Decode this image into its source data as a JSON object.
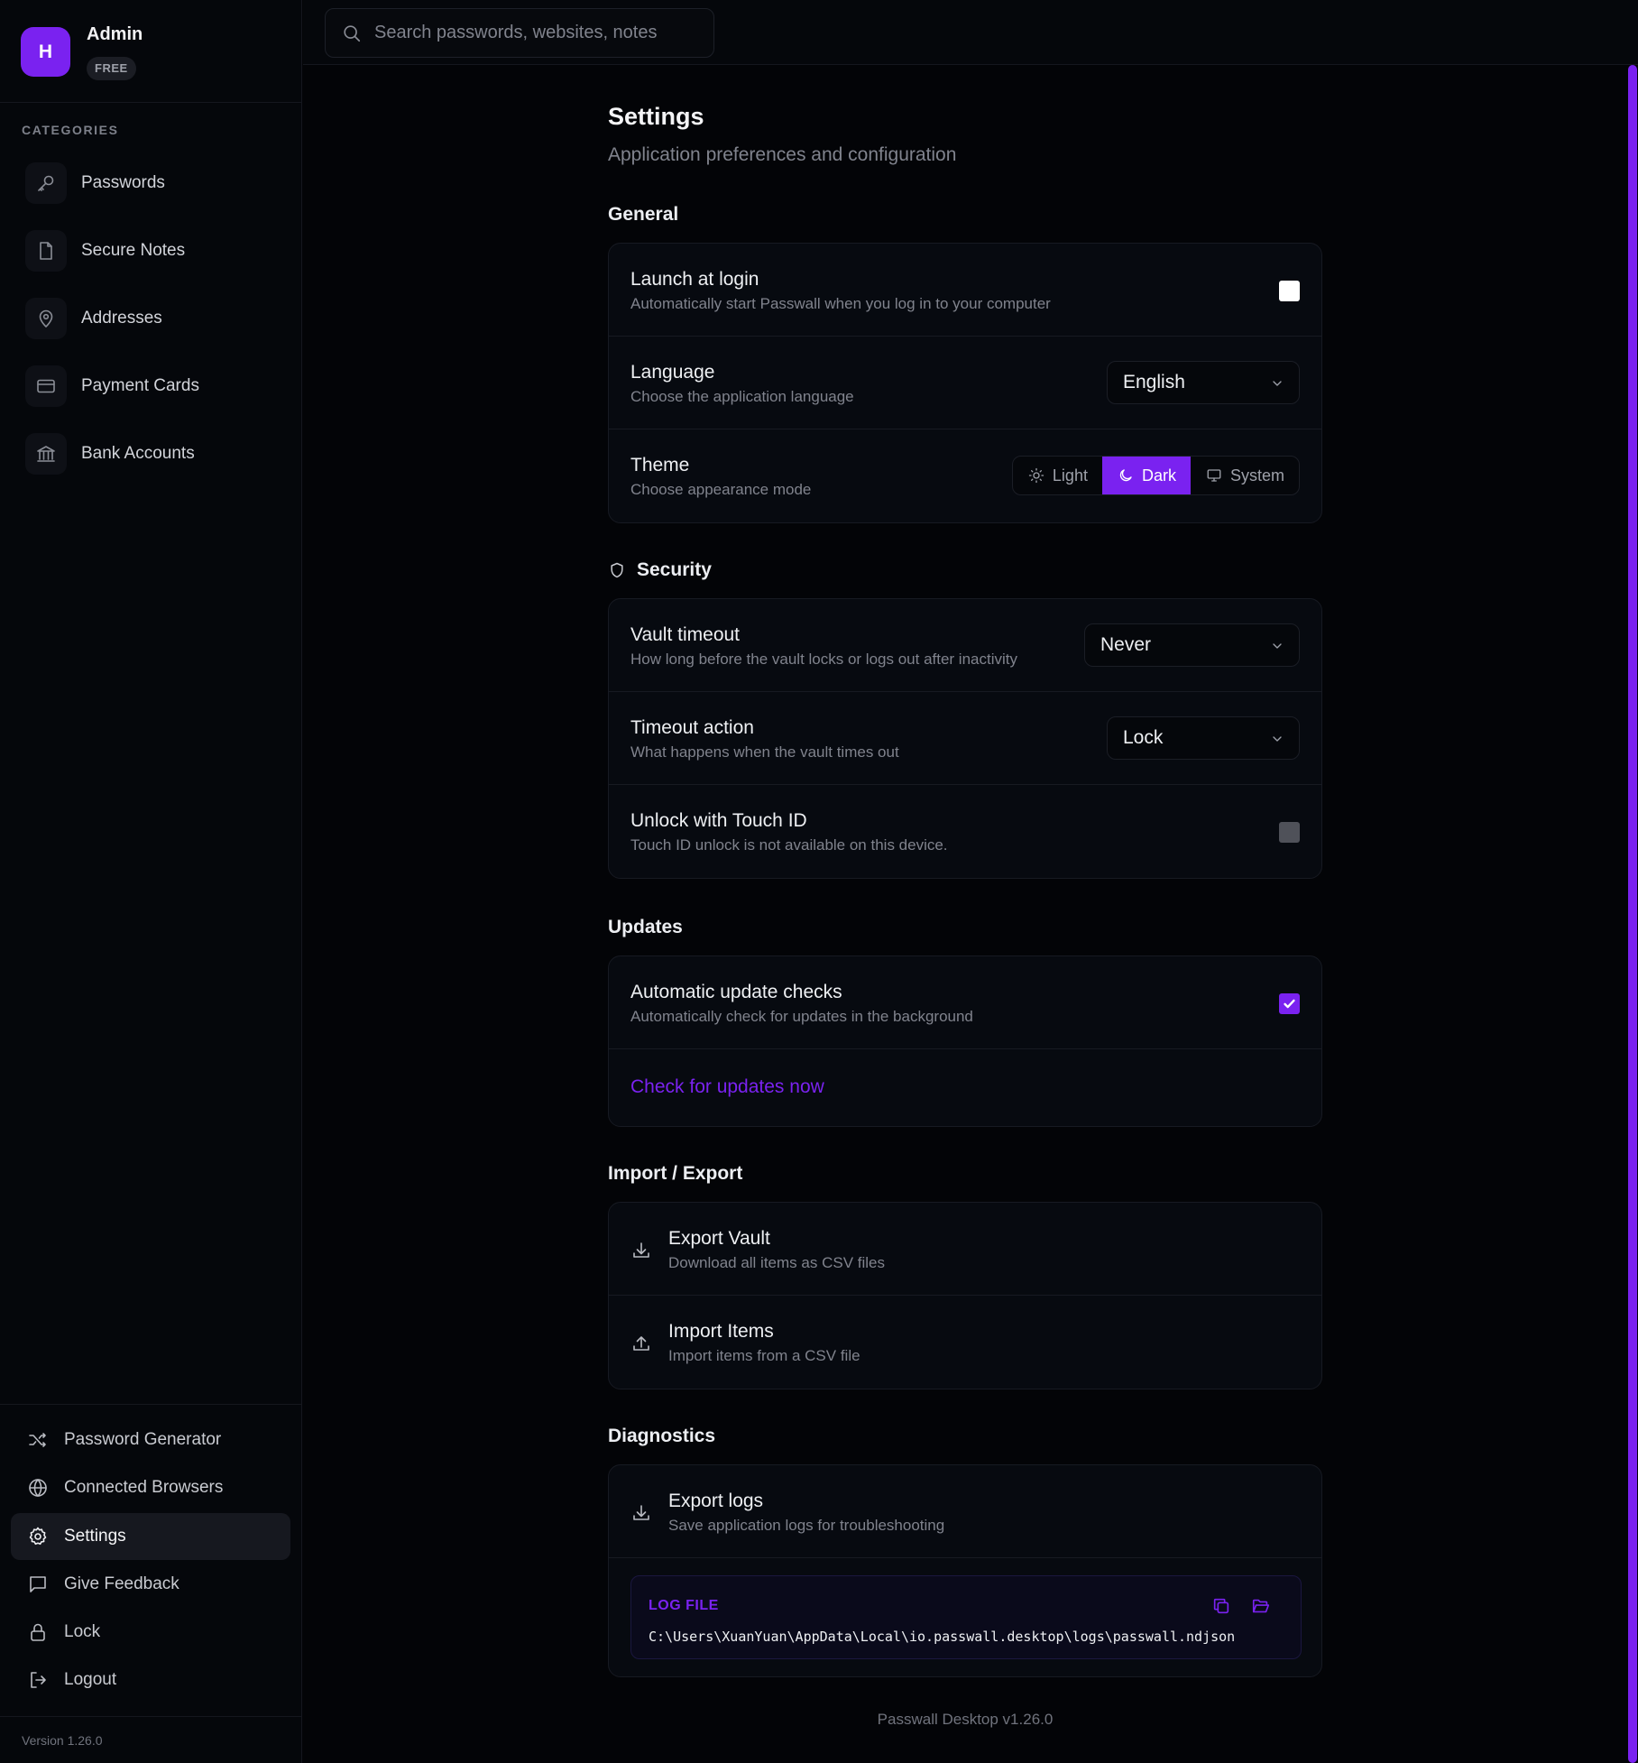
{
  "profile": {
    "initial": "H",
    "name": "Admin",
    "plan": "FREE"
  },
  "sidebar": {
    "categories_label": "CATEGORIES",
    "categories": [
      {
        "label": "Passwords",
        "icon": "key-icon"
      },
      {
        "label": "Secure Notes",
        "icon": "note-icon"
      },
      {
        "label": "Addresses",
        "icon": "map-pin-icon"
      },
      {
        "label": "Payment Cards",
        "icon": "credit-card-icon"
      },
      {
        "label": "Bank Accounts",
        "icon": "bank-icon"
      }
    ],
    "nav": [
      {
        "label": "Password Generator",
        "icon": "shuffle-icon",
        "active": false
      },
      {
        "label": "Connected Browsers",
        "icon": "globe-icon",
        "active": false
      },
      {
        "label": "Settings",
        "icon": "gear-icon",
        "active": true
      },
      {
        "label": "Give Feedback",
        "icon": "message-icon",
        "active": false
      },
      {
        "label": "Lock",
        "icon": "lock-icon",
        "active": false
      },
      {
        "label": "Logout",
        "icon": "logout-icon",
        "active": false
      }
    ],
    "version": "Version 1.26.0"
  },
  "search": {
    "placeholder": "Search passwords, websites, notes",
    "value": ""
  },
  "colors": {
    "accent": "#7a22f0",
    "background": "#030407",
    "card": "#070a10"
  },
  "page": {
    "title": "Settings",
    "subtitle": "Application preferences and configuration"
  },
  "general": {
    "title": "General",
    "launch_title": "Launch at login",
    "launch_desc": "Automatically start Passwall when you log in to your computer",
    "launch_checked": false,
    "language_title": "Language",
    "language_desc": "Choose the application language",
    "language_value": "English",
    "theme_title": "Theme",
    "theme_desc": "Choose appearance mode",
    "theme_options": {
      "light": "Light",
      "dark": "Dark",
      "system": "System"
    },
    "theme_selected": "Dark"
  },
  "security": {
    "title": "Security",
    "timeout_title": "Vault timeout",
    "timeout_desc": "How long before the vault locks or logs out after inactivity",
    "timeout_value": "Never",
    "action_title": "Timeout action",
    "action_desc": "What happens when the vault times out",
    "action_value": "Lock",
    "touch_title": "Unlock with Touch ID",
    "touch_desc": "Touch ID unlock is not available on this device.",
    "touch_enabled": false
  },
  "updates": {
    "title": "Updates",
    "auto_title": "Automatic update checks",
    "auto_desc": "Automatically check for updates in the background",
    "auto_checked": true,
    "check_link": "Check for updates now"
  },
  "import_export": {
    "title": "Import / Export",
    "export_title": "Export Vault",
    "export_desc": "Download all items as CSV files",
    "import_title": "Import Items",
    "import_desc": "Import items from a CSV file"
  },
  "diagnostics": {
    "title": "Diagnostics",
    "logs_title": "Export logs",
    "logs_desc": "Save application logs for troubleshooting",
    "log_label": "LOG FILE",
    "log_path": "C:\\Users\\XuanYuan\\AppData\\Local\\io.passwall.desktop\\logs\\passwall.ndjson"
  },
  "footer": {
    "version": "Passwall Desktop v1.26.0"
  }
}
